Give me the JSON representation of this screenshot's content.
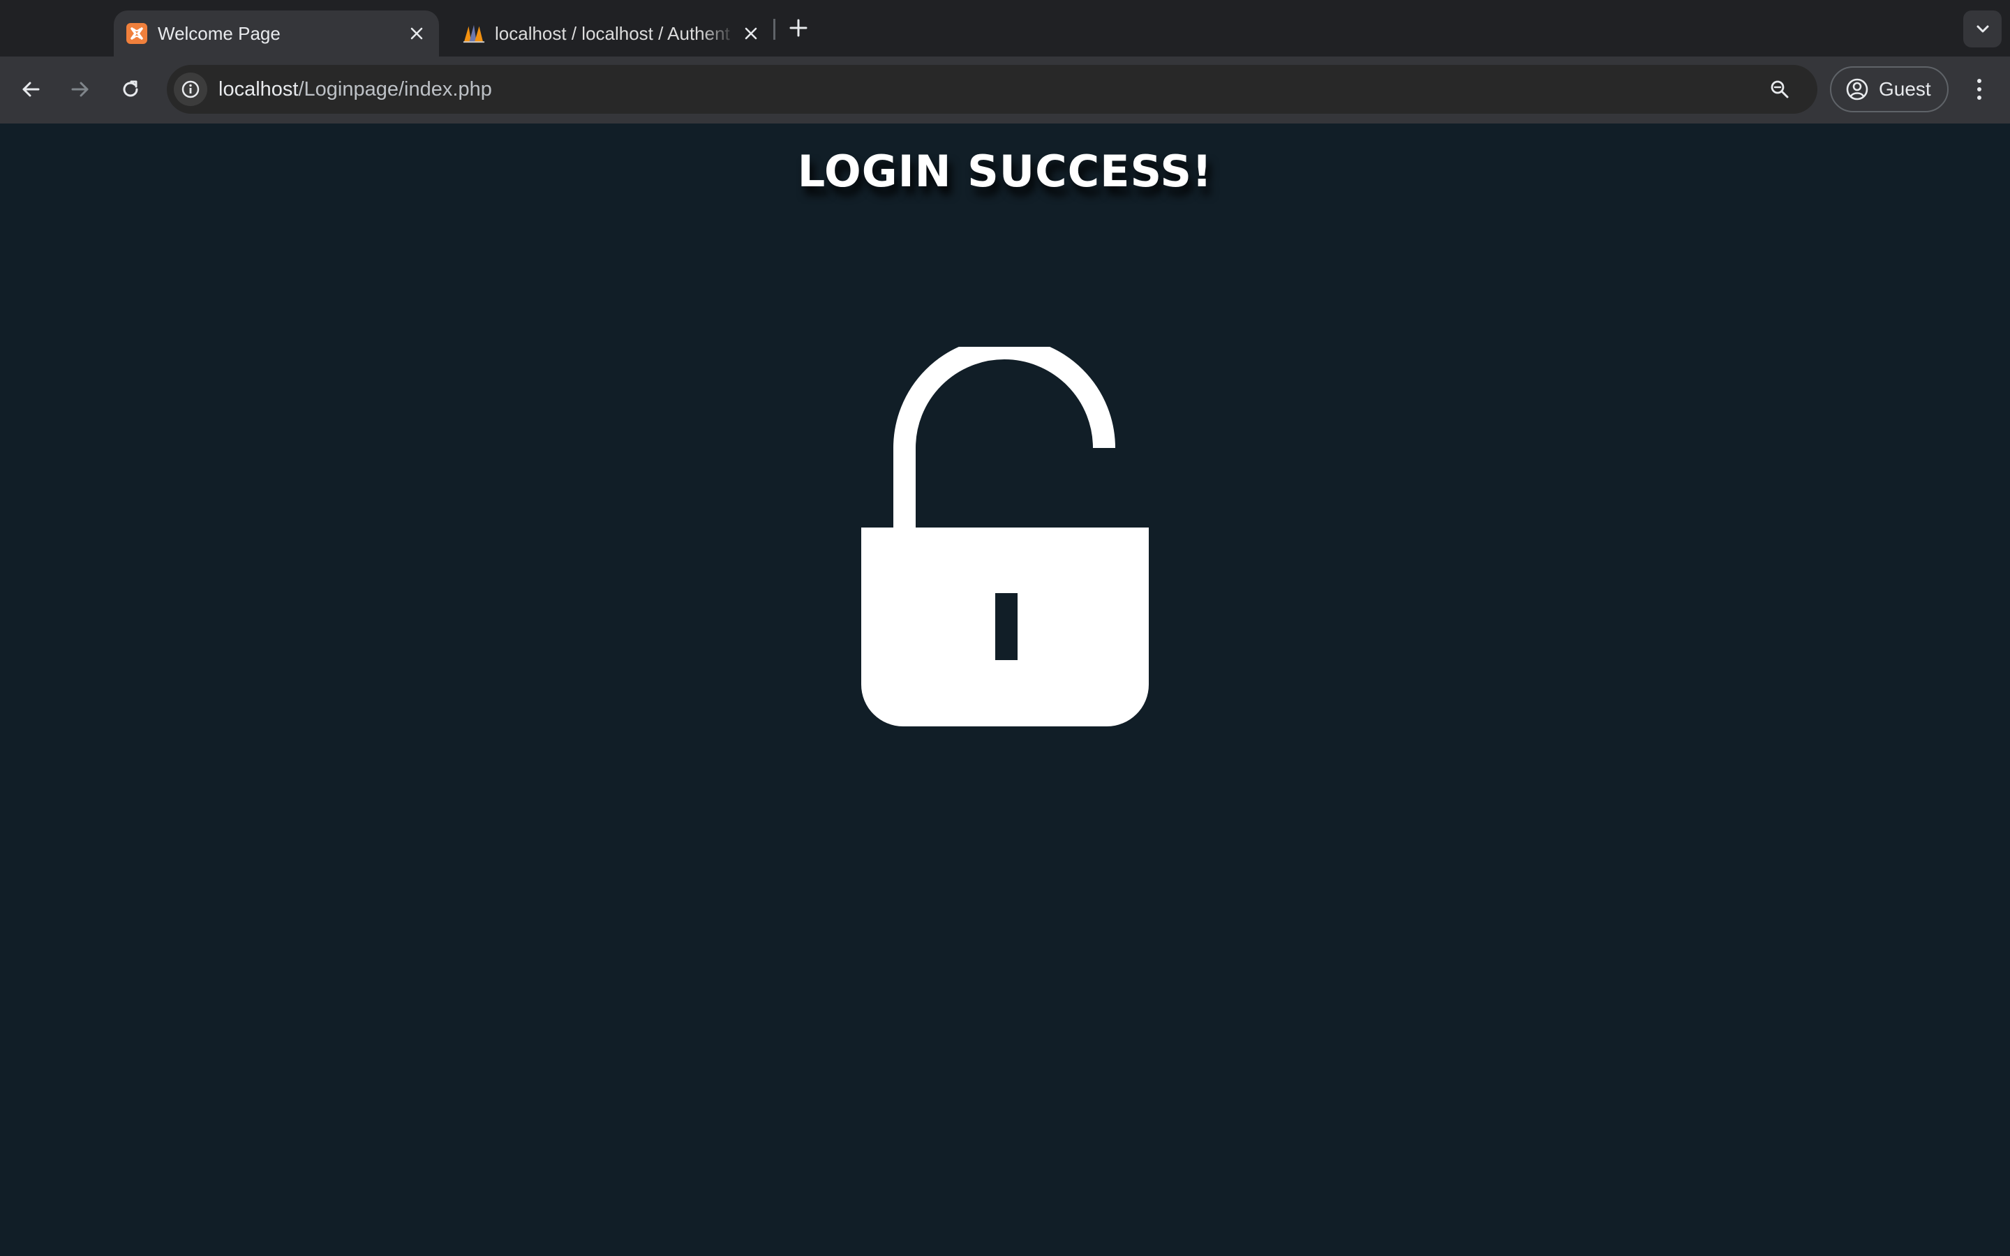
{
  "browser": {
    "tabs": [
      {
        "title": "Welcome Page",
        "active": true,
        "favicon": "xampp-icon"
      },
      {
        "title": "localhost / localhost / Authent",
        "active": false,
        "favicon": "phpmyadmin-icon"
      }
    ],
    "address_bar": {
      "host": "localhost",
      "path": "/Loginpage/index.php"
    },
    "profile_label": "Guest"
  },
  "page": {
    "heading": "LOGIN SUCCESS!",
    "icon": "unlocked-padlock-icon"
  },
  "colors": {
    "page_background": "#111e27",
    "tabstrip": "#202124",
    "toolbar": "#35363a",
    "omnibox": "#282828",
    "text": "#ffffff",
    "xampp_orange": "#f0803c"
  }
}
